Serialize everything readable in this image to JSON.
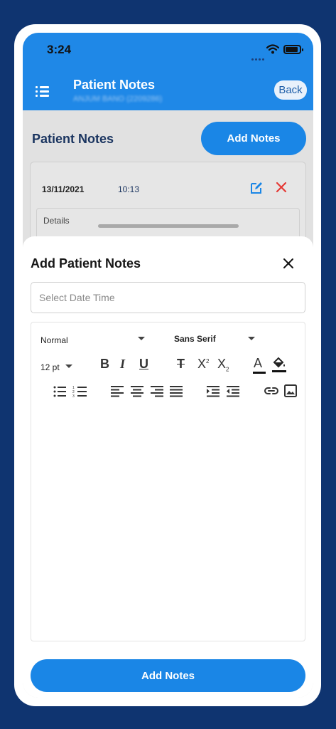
{
  "status_bar": {
    "time": "3:24"
  },
  "app_bar": {
    "title": "Patient Notes",
    "subtitle": "ANJUM BANO (2209286)",
    "back_label": "Back"
  },
  "page": {
    "heading": "Patient Notes",
    "add_button_label": "Add Notes"
  },
  "note_card": {
    "date": "13/11/2021",
    "time": "10:13",
    "details_label": "Details"
  },
  "sheet": {
    "title": "Add Patient Notes",
    "date_placeholder": "Select Date Time",
    "editor": {
      "format": "Normal",
      "font": "Sans Serif",
      "size": "12 pt"
    },
    "submit_label": "Add Notes"
  },
  "colors": {
    "primary": "#1a86e6",
    "background": "#0f3470",
    "delete": "#e53935"
  }
}
